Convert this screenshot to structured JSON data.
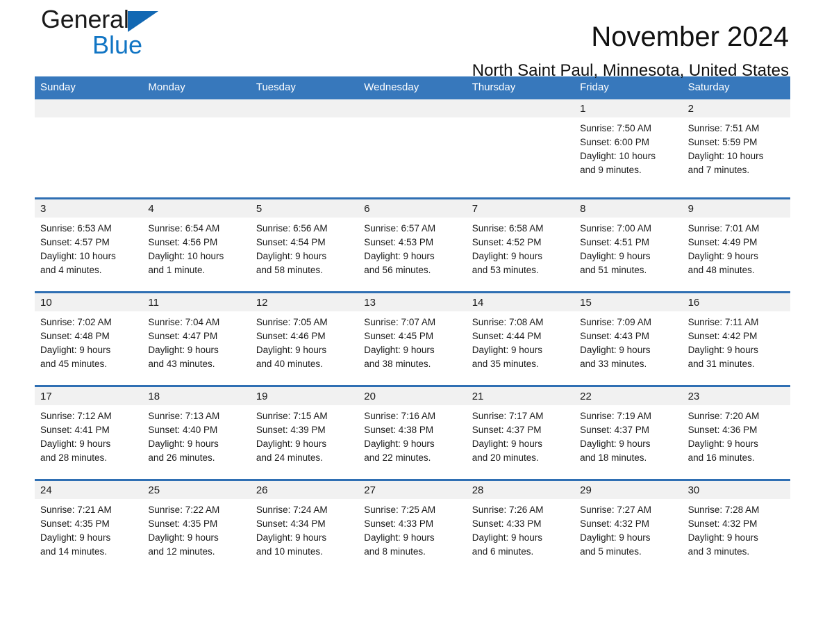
{
  "brand": {
    "name_part1": "General",
    "name_part2": "Blue",
    "triangle_color": "#1268b3",
    "blue_color": "#1175c4"
  },
  "header": {
    "title": "November 2024",
    "subtitle": "North Saint Paul, Minnesota, United States"
  },
  "theme": {
    "header_blue": "#3778bc",
    "row_divider_blue": "#2f6fb3",
    "date_band_gray": "#f1f1f1",
    "text_color": "#1a1a1a"
  },
  "weekdays": [
    "Sunday",
    "Monday",
    "Tuesday",
    "Wednesday",
    "Thursday",
    "Friday",
    "Saturday"
  ],
  "weeks": [
    [
      {
        "day": "",
        "sunrise": "",
        "sunset": "",
        "daylight_line1": "",
        "daylight_line2": ""
      },
      {
        "day": "",
        "sunrise": "",
        "sunset": "",
        "daylight_line1": "",
        "daylight_line2": ""
      },
      {
        "day": "",
        "sunrise": "",
        "sunset": "",
        "daylight_line1": "",
        "daylight_line2": ""
      },
      {
        "day": "",
        "sunrise": "",
        "sunset": "",
        "daylight_line1": "",
        "daylight_line2": ""
      },
      {
        "day": "",
        "sunrise": "",
        "sunset": "",
        "daylight_line1": "",
        "daylight_line2": ""
      },
      {
        "day": "1",
        "sunrise": "Sunrise: 7:50 AM",
        "sunset": "Sunset: 6:00 PM",
        "daylight_line1": "Daylight: 10 hours",
        "daylight_line2": "and 9 minutes."
      },
      {
        "day": "2",
        "sunrise": "Sunrise: 7:51 AM",
        "sunset": "Sunset: 5:59 PM",
        "daylight_line1": "Daylight: 10 hours",
        "daylight_line2": "and 7 minutes."
      }
    ],
    [
      {
        "day": "3",
        "sunrise": "Sunrise: 6:53 AM",
        "sunset": "Sunset: 4:57 PM",
        "daylight_line1": "Daylight: 10 hours",
        "daylight_line2": "and 4 minutes."
      },
      {
        "day": "4",
        "sunrise": "Sunrise: 6:54 AM",
        "sunset": "Sunset: 4:56 PM",
        "daylight_line1": "Daylight: 10 hours",
        "daylight_line2": "and 1 minute."
      },
      {
        "day": "5",
        "sunrise": "Sunrise: 6:56 AM",
        "sunset": "Sunset: 4:54 PM",
        "daylight_line1": "Daylight: 9 hours",
        "daylight_line2": "and 58 minutes."
      },
      {
        "day": "6",
        "sunrise": "Sunrise: 6:57 AM",
        "sunset": "Sunset: 4:53 PM",
        "daylight_line1": "Daylight: 9 hours",
        "daylight_line2": "and 56 minutes."
      },
      {
        "day": "7",
        "sunrise": "Sunrise: 6:58 AM",
        "sunset": "Sunset: 4:52 PM",
        "daylight_line1": "Daylight: 9 hours",
        "daylight_line2": "and 53 minutes."
      },
      {
        "day": "8",
        "sunrise": "Sunrise: 7:00 AM",
        "sunset": "Sunset: 4:51 PM",
        "daylight_line1": "Daylight: 9 hours",
        "daylight_line2": "and 51 minutes."
      },
      {
        "day": "9",
        "sunrise": "Sunrise: 7:01 AM",
        "sunset": "Sunset: 4:49 PM",
        "daylight_line1": "Daylight: 9 hours",
        "daylight_line2": "and 48 minutes."
      }
    ],
    [
      {
        "day": "10",
        "sunrise": "Sunrise: 7:02 AM",
        "sunset": "Sunset: 4:48 PM",
        "daylight_line1": "Daylight: 9 hours",
        "daylight_line2": "and 45 minutes."
      },
      {
        "day": "11",
        "sunrise": "Sunrise: 7:04 AM",
        "sunset": "Sunset: 4:47 PM",
        "daylight_line1": "Daylight: 9 hours",
        "daylight_line2": "and 43 minutes."
      },
      {
        "day": "12",
        "sunrise": "Sunrise: 7:05 AM",
        "sunset": "Sunset: 4:46 PM",
        "daylight_line1": "Daylight: 9 hours",
        "daylight_line2": "and 40 minutes."
      },
      {
        "day": "13",
        "sunrise": "Sunrise: 7:07 AM",
        "sunset": "Sunset: 4:45 PM",
        "daylight_line1": "Daylight: 9 hours",
        "daylight_line2": "and 38 minutes."
      },
      {
        "day": "14",
        "sunrise": "Sunrise: 7:08 AM",
        "sunset": "Sunset: 4:44 PM",
        "daylight_line1": "Daylight: 9 hours",
        "daylight_line2": "and 35 minutes."
      },
      {
        "day": "15",
        "sunrise": "Sunrise: 7:09 AM",
        "sunset": "Sunset: 4:43 PM",
        "daylight_line1": "Daylight: 9 hours",
        "daylight_line2": "and 33 minutes."
      },
      {
        "day": "16",
        "sunrise": "Sunrise: 7:11 AM",
        "sunset": "Sunset: 4:42 PM",
        "daylight_line1": "Daylight: 9 hours",
        "daylight_line2": "and 31 minutes."
      }
    ],
    [
      {
        "day": "17",
        "sunrise": "Sunrise: 7:12 AM",
        "sunset": "Sunset: 4:41 PM",
        "daylight_line1": "Daylight: 9 hours",
        "daylight_line2": "and 28 minutes."
      },
      {
        "day": "18",
        "sunrise": "Sunrise: 7:13 AM",
        "sunset": "Sunset: 4:40 PM",
        "daylight_line1": "Daylight: 9 hours",
        "daylight_line2": "and 26 minutes."
      },
      {
        "day": "19",
        "sunrise": "Sunrise: 7:15 AM",
        "sunset": "Sunset: 4:39 PM",
        "daylight_line1": "Daylight: 9 hours",
        "daylight_line2": "and 24 minutes."
      },
      {
        "day": "20",
        "sunrise": "Sunrise: 7:16 AM",
        "sunset": "Sunset: 4:38 PM",
        "daylight_line1": "Daylight: 9 hours",
        "daylight_line2": "and 22 minutes."
      },
      {
        "day": "21",
        "sunrise": "Sunrise: 7:17 AM",
        "sunset": "Sunset: 4:37 PM",
        "daylight_line1": "Daylight: 9 hours",
        "daylight_line2": "and 20 minutes."
      },
      {
        "day": "22",
        "sunrise": "Sunrise: 7:19 AM",
        "sunset": "Sunset: 4:37 PM",
        "daylight_line1": "Daylight: 9 hours",
        "daylight_line2": "and 18 minutes."
      },
      {
        "day": "23",
        "sunrise": "Sunrise: 7:20 AM",
        "sunset": "Sunset: 4:36 PM",
        "daylight_line1": "Daylight: 9 hours",
        "daylight_line2": "and 16 minutes."
      }
    ],
    [
      {
        "day": "24",
        "sunrise": "Sunrise: 7:21 AM",
        "sunset": "Sunset: 4:35 PM",
        "daylight_line1": "Daylight: 9 hours",
        "daylight_line2": "and 14 minutes."
      },
      {
        "day": "25",
        "sunrise": "Sunrise: 7:22 AM",
        "sunset": "Sunset: 4:35 PM",
        "daylight_line1": "Daylight: 9 hours",
        "daylight_line2": "and 12 minutes."
      },
      {
        "day": "26",
        "sunrise": "Sunrise: 7:24 AM",
        "sunset": "Sunset: 4:34 PM",
        "daylight_line1": "Daylight: 9 hours",
        "daylight_line2": "and 10 minutes."
      },
      {
        "day": "27",
        "sunrise": "Sunrise: 7:25 AM",
        "sunset": "Sunset: 4:33 PM",
        "daylight_line1": "Daylight: 9 hours",
        "daylight_line2": "and 8 minutes."
      },
      {
        "day": "28",
        "sunrise": "Sunrise: 7:26 AM",
        "sunset": "Sunset: 4:33 PM",
        "daylight_line1": "Daylight: 9 hours",
        "daylight_line2": "and 6 minutes."
      },
      {
        "day": "29",
        "sunrise": "Sunrise: 7:27 AM",
        "sunset": "Sunset: 4:32 PM",
        "daylight_line1": "Daylight: 9 hours",
        "daylight_line2": "and 5 minutes."
      },
      {
        "day": "30",
        "sunrise": "Sunrise: 7:28 AM",
        "sunset": "Sunset: 4:32 PM",
        "daylight_line1": "Daylight: 9 hours",
        "daylight_line2": "and 3 minutes."
      }
    ]
  ]
}
